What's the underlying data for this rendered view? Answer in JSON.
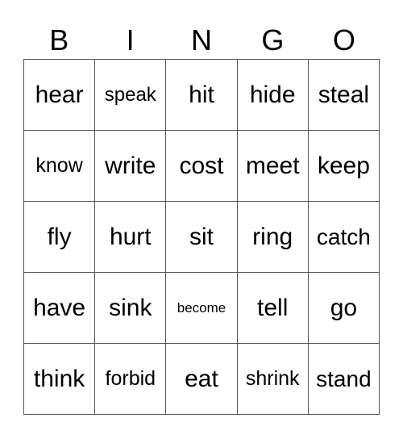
{
  "header": [
    "B",
    "I",
    "N",
    "G",
    "O"
  ],
  "cells": [
    [
      "hear",
      "speak",
      "hit",
      "hide",
      "steal"
    ],
    [
      "know",
      "write",
      "cost",
      "meet",
      "keep"
    ],
    [
      "fly",
      "hurt",
      "sit",
      "ring",
      "catch"
    ],
    [
      "have",
      "sink",
      "become",
      "tell",
      "go"
    ],
    [
      "think",
      "forbid",
      "eat",
      "shrink",
      "stand"
    ]
  ]
}
